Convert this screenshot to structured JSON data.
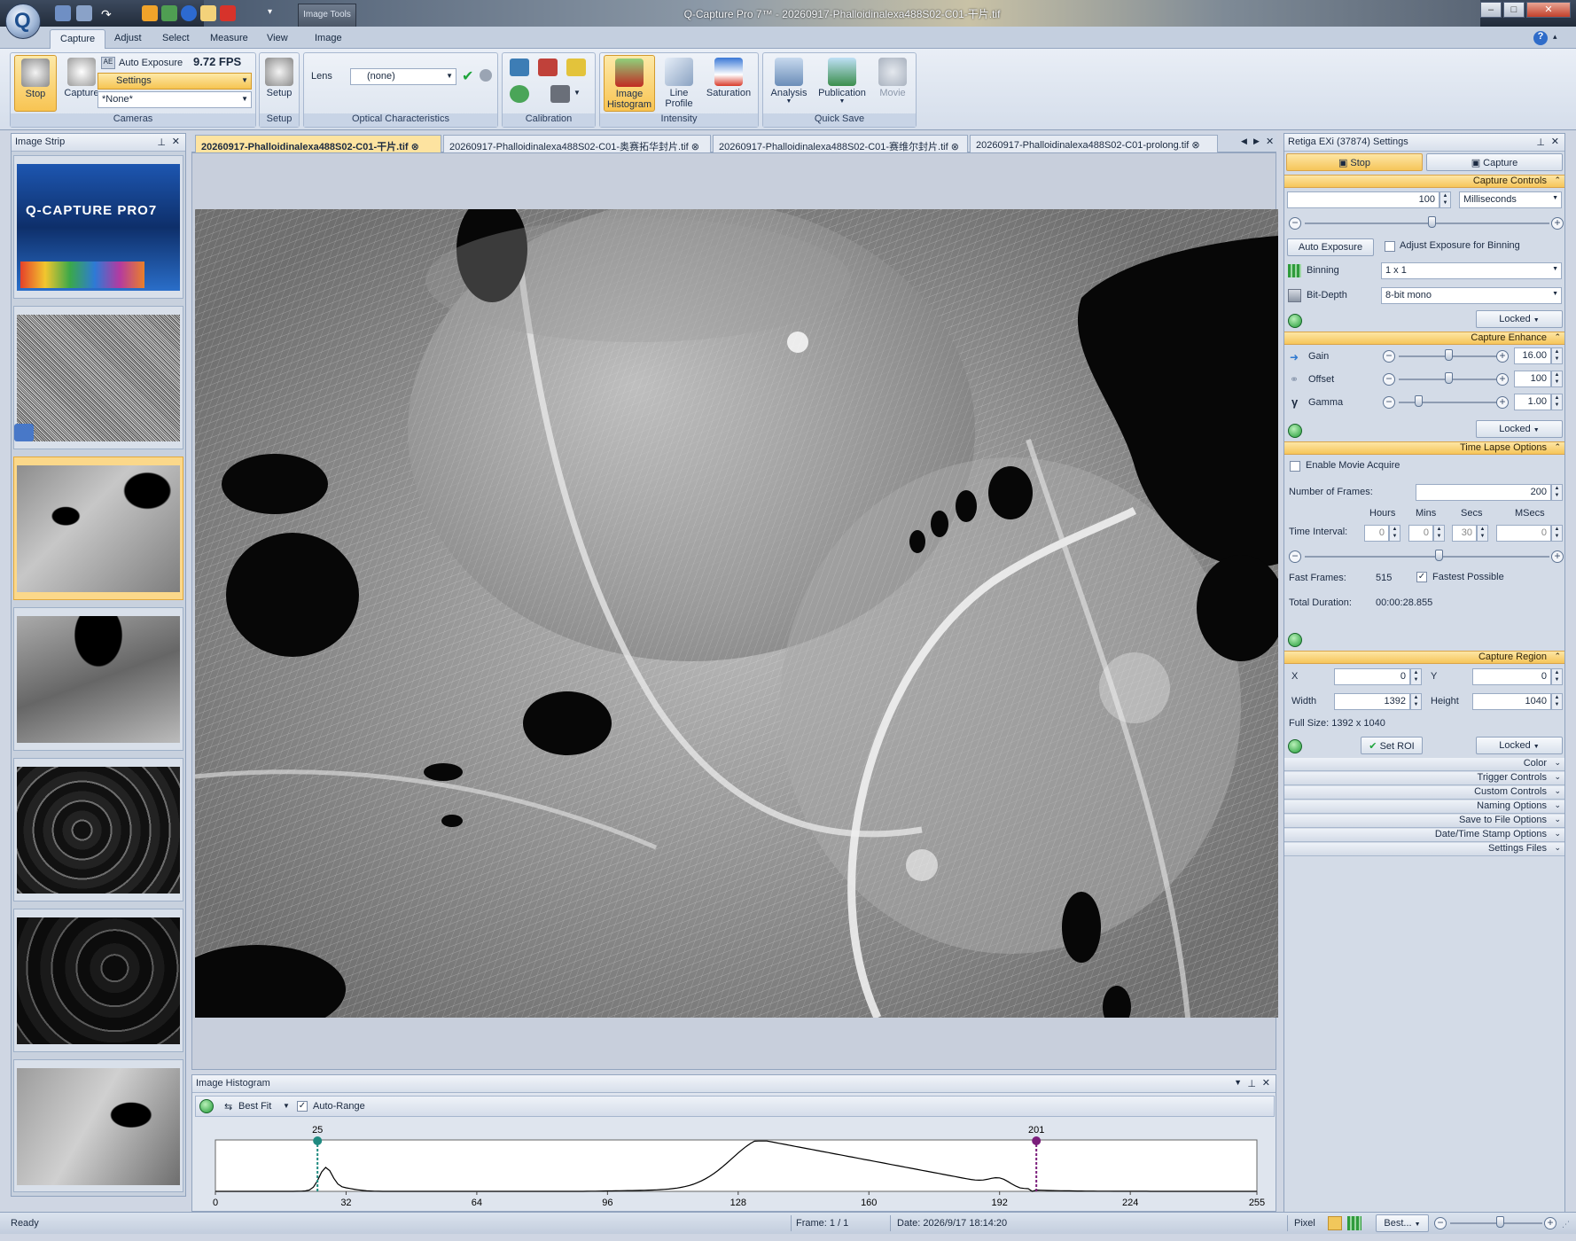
{
  "window": {
    "title": "Q-Capture Pro 7™ - 20260917-Phalloidinalexa488S02-C01-干片.tif",
    "image_tools_tab": "Image Tools",
    "minimize": "–",
    "maximize": "□",
    "close": "✕"
  },
  "ribbon": {
    "tabs": [
      "Capture",
      "Adjust",
      "Select",
      "Measure",
      "View",
      "Image"
    ],
    "active_tab": "Capture",
    "cameras": {
      "stop_label": "Stop",
      "capture_label": "Capture",
      "auto_exposure_label": "Auto Exposure",
      "fps": "9.72 FPS",
      "settings_label": "Settings",
      "preset_value": "*None*",
      "group_label": "Cameras"
    },
    "setup": {
      "label": "Setup",
      "group_label": "Setup"
    },
    "optical": {
      "lens_label": "Lens",
      "lens_value": "(none)",
      "group_label": "Optical Characteristics"
    },
    "calibration": {
      "group_label": "Calibration"
    },
    "intensity": {
      "histogram_label": "Image Histogram",
      "line_profile_label": "Line Profile",
      "saturation_label": "Saturation",
      "group_label": "Intensity"
    },
    "quick_save": {
      "analysis_label": "Analysis",
      "publication_label": "Publication",
      "movie_label": "Movie",
      "group_label": "Quick Save"
    }
  },
  "image_strip": {
    "title": "Image Strip",
    "splash_title": "Q-CAPTURE PRO7"
  },
  "document_tabs": [
    {
      "label": "20260917-Phalloidinalexa488S02-C01-干片.tif",
      "active": true
    },
    {
      "label": "20260917-Phalloidinalexa488S02-C01-奥赛拓华封片.tif",
      "active": false
    },
    {
      "label": "20260917-Phalloidinalexa488S02-C01-赛维尔封片.tif",
      "active": false
    },
    {
      "label": "20260917-Phalloidinalexa488S02-C01-prolong.tif",
      "active": false
    }
  ],
  "histogram": {
    "title": "Image Histogram",
    "best_fit_label": "Best Fit",
    "auto_range_label": "Auto-Range",
    "low_marker": "25",
    "high_marker": "201",
    "axis_ticks": [
      "0",
      "32",
      "64",
      "96",
      "128",
      "160",
      "192",
      "224",
      "255"
    ],
    "low_value": 25,
    "high_value": 201,
    "colors": {
      "low": "#1f8a80",
      "high": "#7b1e7b"
    }
  },
  "settings_panel": {
    "title": "Retiga EXi (37874) Settings",
    "stop_label": "Stop",
    "capture_label": "Capture",
    "capture_controls": {
      "header": "Capture Controls",
      "exposure_value": "100",
      "exposure_unit": "Milliseconds",
      "exposure_slider_level": 0.52,
      "auto_exposure_button": "Auto Exposure",
      "adjust_binning_label": "Adjust Exposure for Binning",
      "binning_label": "Binning",
      "binning_value": "1 x 1",
      "bitdepth_label": "Bit-Depth",
      "bitdepth_value": "8-bit mono",
      "locked_label": "Locked"
    },
    "capture_enhance": {
      "header": "Capture Enhance",
      "gain_label": "Gain",
      "gain_value": "16.00",
      "gain_level": 0.5,
      "offset_label": "Offset",
      "offset_value": "100",
      "offset_level": 0.5,
      "gamma_label": "Gamma",
      "gamma_value": "1.00",
      "gamma_level": 0.2,
      "locked_label": "Locked"
    },
    "time_lapse": {
      "header": "Time Lapse Options",
      "enable_movie_label": "Enable Movie Acquire",
      "frames_label": "Number of  Frames:",
      "frames_value": "200",
      "hours_label": "Hours",
      "mins_label": "Mins",
      "secs_label": "Secs",
      "msecs_label": "MSecs",
      "interval_label": "Time Interval:",
      "hours_value": "0",
      "mins_value": "0",
      "secs_value": "30",
      "msecs_value": "0",
      "interval_slider_level": 0.55,
      "fast_frames_label": "Fast Frames:",
      "fast_frames_value": "515",
      "fastest_label": "Fastest Possible",
      "total_duration_label": "Total Duration:",
      "total_duration_value": "00:00:28.855"
    },
    "capture_region": {
      "header": "Capture Region",
      "x_label": "X",
      "x_value": "0",
      "y_label": "Y",
      "y_value": "0",
      "width_label": "Width",
      "width_value": "1392",
      "height_label": "Height",
      "height_value": "1040",
      "full_size": "Full Size: 1392 x 1040",
      "set_roi_label": "Set ROI",
      "locked_label": "Locked"
    },
    "collapsed_sections": [
      "Color",
      "Trigger Controls",
      "Custom Controls",
      "Naming Options",
      "Save to File Options",
      "Date/Time Stamp Options",
      "Settings Files"
    ]
  },
  "status_bar": {
    "ready": "Ready",
    "frame": "Frame: 1 / 1",
    "date": "Date: 2026/9/17 18:14:20",
    "pixel": "Pixel",
    "zoom": "Best...",
    "zoom_level": 0.55
  }
}
